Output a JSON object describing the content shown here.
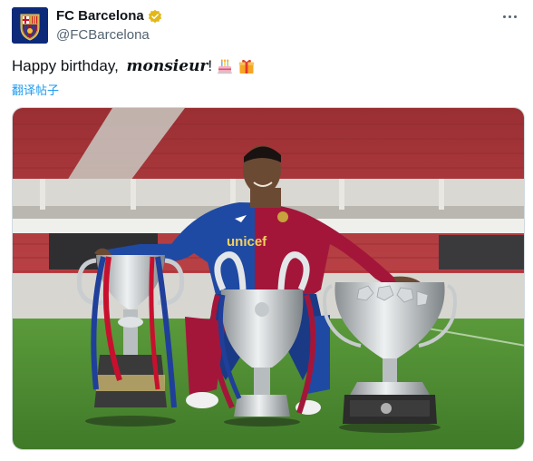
{
  "author": {
    "display_name": "FC Barcelona",
    "handle": "@FCBarcelona",
    "avatar_icon": "fc-barcelona-crest-icon",
    "verified_icon": "verified-badge-icon"
  },
  "post": {
    "text_plain": "Happy birthday, ",
    "text_emphasis": "monsieur",
    "text_tail": "!",
    "emojis": [
      "birthday-cake-icon",
      "wrapped-gift-icon"
    ],
    "translate_label": "翻译帖子"
  },
  "menu": {
    "icon": "more-options-icon"
  },
  "colors": {
    "handle_gray": "#536471",
    "link_blue": "#1d9bf0",
    "verified_gold": "#e2b719",
    "barca_blue": "#1b3f8f",
    "barca_red": "#a3163a",
    "stadium_red": "#b8343b",
    "pitch_green": "#4f8a34"
  },
  "media": {
    "alt": "Player in FC Barcelona kit kneeling on pitch behind three trophies",
    "kit_sponsor": "unicef"
  }
}
